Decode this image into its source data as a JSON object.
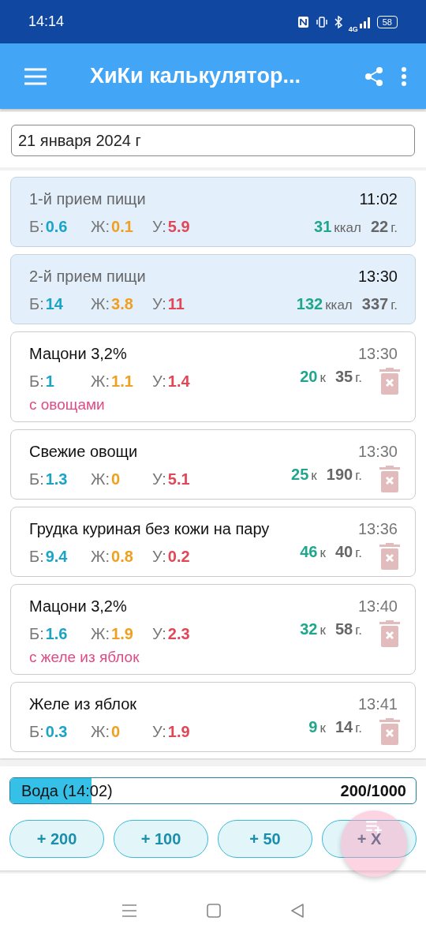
{
  "status_bar": {
    "time": "14:14",
    "battery": "58",
    "network": "4G"
  },
  "app_bar": {
    "title": "ХиКи калькулятор..."
  },
  "date_field": {
    "value": "21 января 2024 г"
  },
  "entries": [
    {
      "kind": "meal",
      "name": "1-й прием пищи",
      "time": "11:02",
      "protein_label": "Б:",
      "protein": "0.6",
      "fat_label": "Ж:",
      "fat": "0.1",
      "carbs_label": "У:",
      "carbs": "5.9",
      "kcal": "31",
      "kcal_unit": "ккал",
      "grams": "22",
      "grams_unit": "г."
    },
    {
      "kind": "meal",
      "name": "2-й прием пищи",
      "time": "13:30",
      "protein_label": "Б:",
      "protein": "14",
      "fat_label": "Ж:",
      "fat": "3.8",
      "carbs_label": "У:",
      "carbs": "11",
      "kcal": "132",
      "kcal_unit": "ккал",
      "grams": "337",
      "grams_unit": "г."
    },
    {
      "kind": "food",
      "name": "Мацони 3,2%",
      "time": "13:30",
      "protein_label": "Б:",
      "protein": "1",
      "fat_label": "Ж:",
      "fat": "1.1",
      "carbs_label": "У:",
      "carbs": "1.4",
      "kcal": "20",
      "kcal_unit": "к",
      "grams": "35",
      "grams_unit": "г.",
      "note": "с овощами"
    },
    {
      "kind": "food",
      "name": "Свежие овощи",
      "time": "13:30",
      "protein_label": "Б:",
      "protein": "1.3",
      "fat_label": "Ж:",
      "fat": "0",
      "carbs_label": "У:",
      "carbs": "5.1",
      "kcal": "25",
      "kcal_unit": "к",
      "grams": "190",
      "grams_unit": "г."
    },
    {
      "kind": "food",
      "name": "Грудка куриная без кожи на пару",
      "time": "13:36",
      "protein_label": "Б:",
      "protein": "9.4",
      "fat_label": "Ж:",
      "fat": "0.8",
      "carbs_label": "У:",
      "carbs": "0.2",
      "kcal": "46",
      "kcal_unit": "к",
      "grams": "40",
      "grams_unit": "г."
    },
    {
      "kind": "food",
      "name": "Мацони 3,2%",
      "time": "13:40",
      "protein_label": "Б:",
      "protein": "1.6",
      "fat_label": "Ж:",
      "fat": "1.9",
      "carbs_label": "У:",
      "carbs": "2.3",
      "kcal": "32",
      "kcal_unit": "к",
      "grams": "58",
      "grams_unit": "г.",
      "note": "с желе из яблок"
    },
    {
      "kind": "food",
      "name": "Желе из яблок",
      "time": "13:41",
      "protein_label": "Б:",
      "protein": "0.3",
      "fat_label": "Ж:",
      "fat": "0",
      "carbs_label": "У:",
      "carbs": "1.9",
      "kcal": "9",
      "kcal_unit": "к",
      "grams": "14",
      "grams_unit": "г."
    }
  ],
  "water": {
    "label": "Вода (14:02)",
    "reading": "200/1000",
    "level": 0.2,
    "buttons": [
      "+ 200",
      "+ 100",
      "+ 50",
      "+ X"
    ]
  }
}
